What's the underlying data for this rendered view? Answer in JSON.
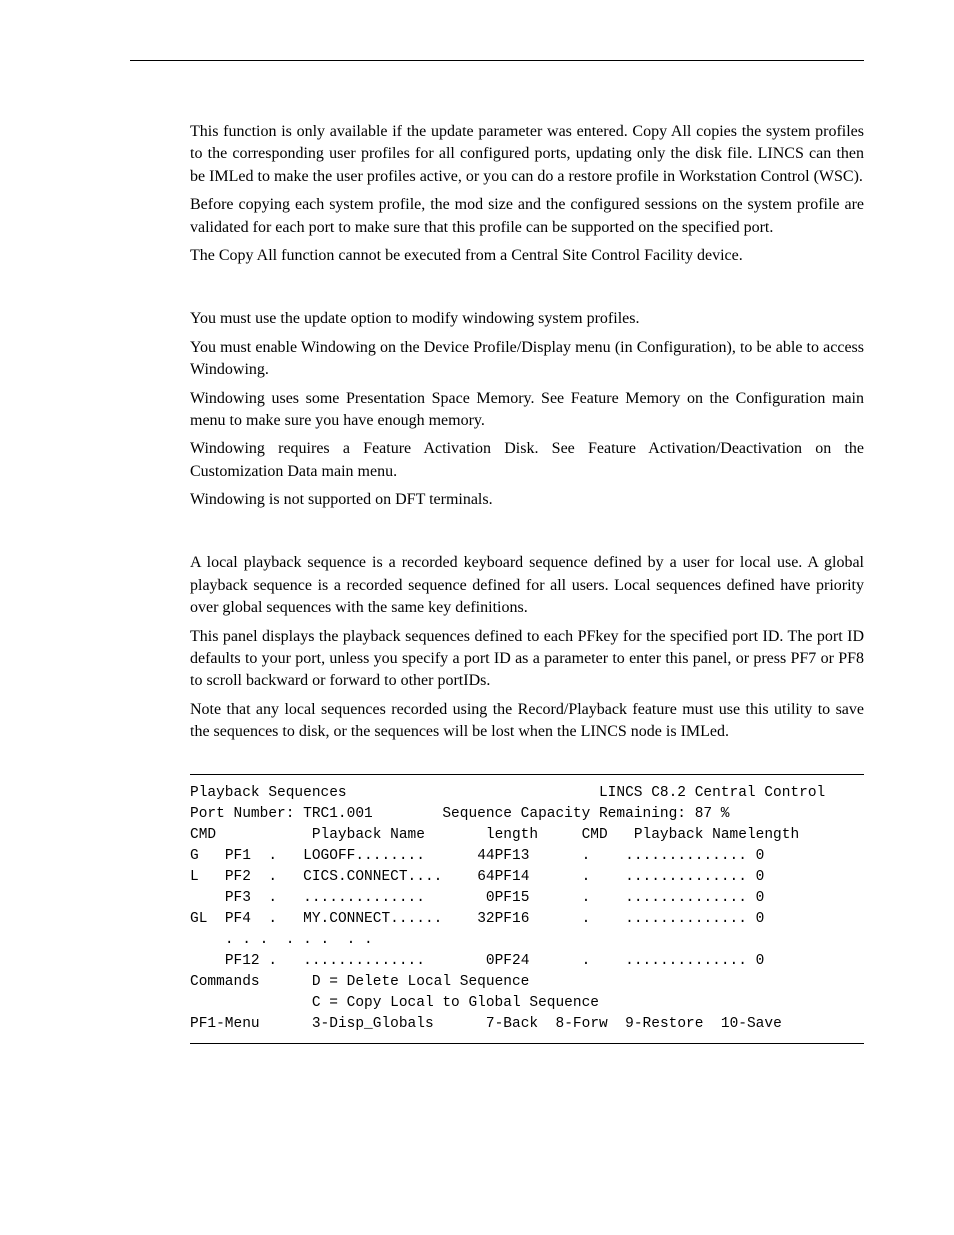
{
  "paragraphs": {
    "p1": "This function is only available if the update parameter was entered. Copy All copies the system profiles to the corresponding user profiles for all configured ports, updating only the disk file. LINCS can then be IMLed to make the user profiles active, or you can do a restore profile in Workstation Control (WSC).",
    "p2": "Before copying each system profile, the mod size and the configured sessions on the system profile are validated for each port to make sure that this profile can be supported on the specified port.",
    "p3": "The Copy All function cannot be executed from a Central Site Control Facility device.",
    "p4": "You must use the update option to modify windowing system profiles.",
    "p5": "You must enable Windowing on the Device Profile/Display menu (in Configuration), to be able to access Windowing.",
    "p6": "Windowing uses some Presentation Space Memory. See Feature Memory on the Configuration main menu to make sure you have enough memory.",
    "p7": "Windowing requires a Feature Activation Disk. See Feature Activation/Deactivation on the Customization Data main menu.",
    "p8": "Windowing is not supported on DFT terminals.",
    "p9": "A local playback sequence is a recorded keyboard sequence defined by a user for local use. A global playback sequence is a recorded sequence defined for all users. Local sequences defined have priority over global sequences with the same key definitions.",
    "p10": "This panel displays the playback sequences defined to each PFkey for the specified port ID. The port ID defaults to your port, unless you specify a port ID as a parameter to enter this panel, or press PF7 or PF8 to scroll backward or forward to other portIDs.",
    "p11": "Note that any local sequences recorded using the Record/Playback feature must use this utility to save the sequences to disk, or the sequences will be lost when the LINCS node is IMLed."
  },
  "terminal": {
    "title_left": "Playback Sequences",
    "title_right": "LINCS C8.2 Central Control",
    "port_label": "Port Number: TRC1.001",
    "capacity_label": "Sequence Capacity Remaining: 87 %",
    "header_cmd": "CMD",
    "header_name": "Playback Name",
    "header_length": "length",
    "header_cmd2": "CMD",
    "header_name2": "Playback Name",
    "header_length2": "length",
    "rows": [
      {
        "flag": "G",
        "pf": "PF1",
        "dot": ".",
        "name": "LOGOFF........",
        "len": "44",
        "pf2": "PF13",
        "dot2": ".",
        "name2": "..............",
        "len2": "0"
      },
      {
        "flag": "L",
        "pf": "PF2",
        "dot": ".",
        "name": "CICS.CONNECT....",
        "len": "64",
        "pf2": "PF14",
        "dot2": ".",
        "name2": "..............",
        "len2": "0"
      },
      {
        "flag": "",
        "pf": "PF3",
        "dot": ".",
        "name": "..............",
        "len": "0",
        "pf2": "PF15",
        "dot2": ".",
        "name2": "..............",
        "len2": "0"
      },
      {
        "flag": "GL",
        "pf": "PF4",
        "dot": ".",
        "name": "MY.CONNECT......",
        "len": "32",
        "pf2": "PF16",
        "dot2": ".",
        "name2": "..............",
        "len2": "0"
      }
    ],
    "ellipsis": ". . .  . . .  . .",
    "row_last": {
      "flag": "",
      "pf": "PF12",
      "dot": ".",
      "name": "..............",
      "len": "0",
      "pf2": "PF24",
      "dot2": ".",
      "name2": "..............",
      "len2": "0"
    },
    "commands_label": "Commands",
    "cmd_d": "D = Delete Local Sequence",
    "cmd_c": "C = Copy Local to Global Sequence",
    "footer_pf1": "PF1-Menu",
    "footer_3": "3-Disp_Globals",
    "footer_7": "7-Back",
    "footer_8": "8-Forw",
    "footer_9": "9-Restore",
    "footer_10": "10-Save"
  }
}
